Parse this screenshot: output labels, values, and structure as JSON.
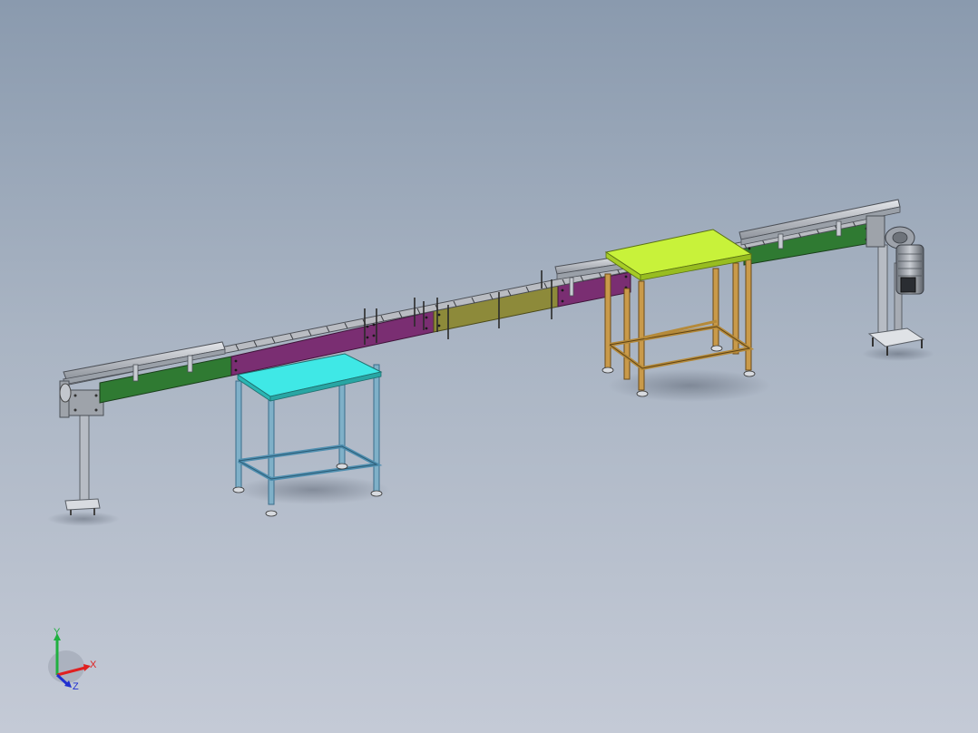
{
  "triad": {
    "x_label": "X",
    "y_label": "Y",
    "z_label": "Z",
    "x_color": "#e02020",
    "y_color": "#20b040",
    "z_color": "#2030d0"
  },
  "colors": {
    "background_top": "#8a9aae",
    "background_bottom": "#c4cad6",
    "conveyor_green": "#2f7a32",
    "conveyor_purple": "#7a2e72",
    "conveyor_olive": "#8d8a3a",
    "table_cyan_top": "#3fe8e6",
    "table_lime_top": "#c8f23a",
    "table_orange_frame": "#b58a3a",
    "rail_silver": "#b8bcc4",
    "motor_steel": "#8f959e"
  }
}
